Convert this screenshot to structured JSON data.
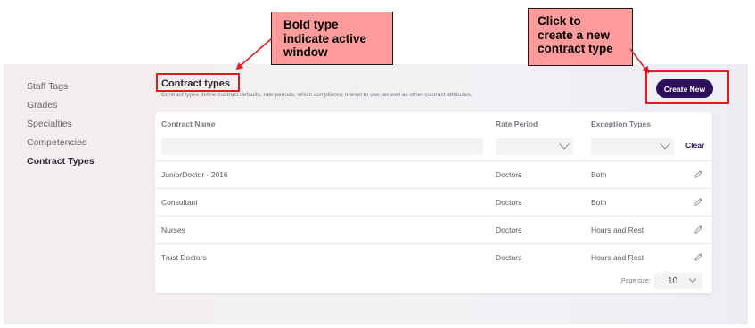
{
  "sidebar": {
    "items": [
      {
        "label": "Staff Tags"
      },
      {
        "label": "Grades"
      },
      {
        "label": "Specialties"
      },
      {
        "label": "Competencies"
      },
      {
        "label": "Contract Types",
        "active": true
      }
    ]
  },
  "header": {
    "title": "Contract types",
    "description": "Contract types define contract defaults, rate periods, which compliance ruleset to use, as well as other contract attributes.",
    "create_label": "Create New"
  },
  "table": {
    "columns": [
      "Contract Name",
      "Rate Period",
      "Exception Types"
    ],
    "filters": {
      "name_value": "",
      "rate_period_value": "",
      "exception_value": "",
      "clear_label": "Clear"
    },
    "rows": [
      {
        "name": "JuniorDoctor - 2016",
        "rate_period": "Doctors",
        "exception": "Both"
      },
      {
        "name": "Consultant",
        "rate_period": "Doctors",
        "exception": "Both"
      },
      {
        "name": "Nurses",
        "rate_period": "Doctors",
        "exception": "Hours and Rest"
      },
      {
        "name": "Trust Doctors",
        "rate_period": "Doctors",
        "exception": "Hours and Rest"
      }
    ],
    "pagination": {
      "label": "Page size:",
      "value": "10"
    }
  },
  "annotations": {
    "bold_note": "Bold type\nindicate active\nwindow",
    "create_note": "Click to\ncreate a new\ncontract type"
  },
  "colors": {
    "accent": "#2e0f5c",
    "callout_fill": "#ff9b9b",
    "highlight": "#e21b1b"
  }
}
